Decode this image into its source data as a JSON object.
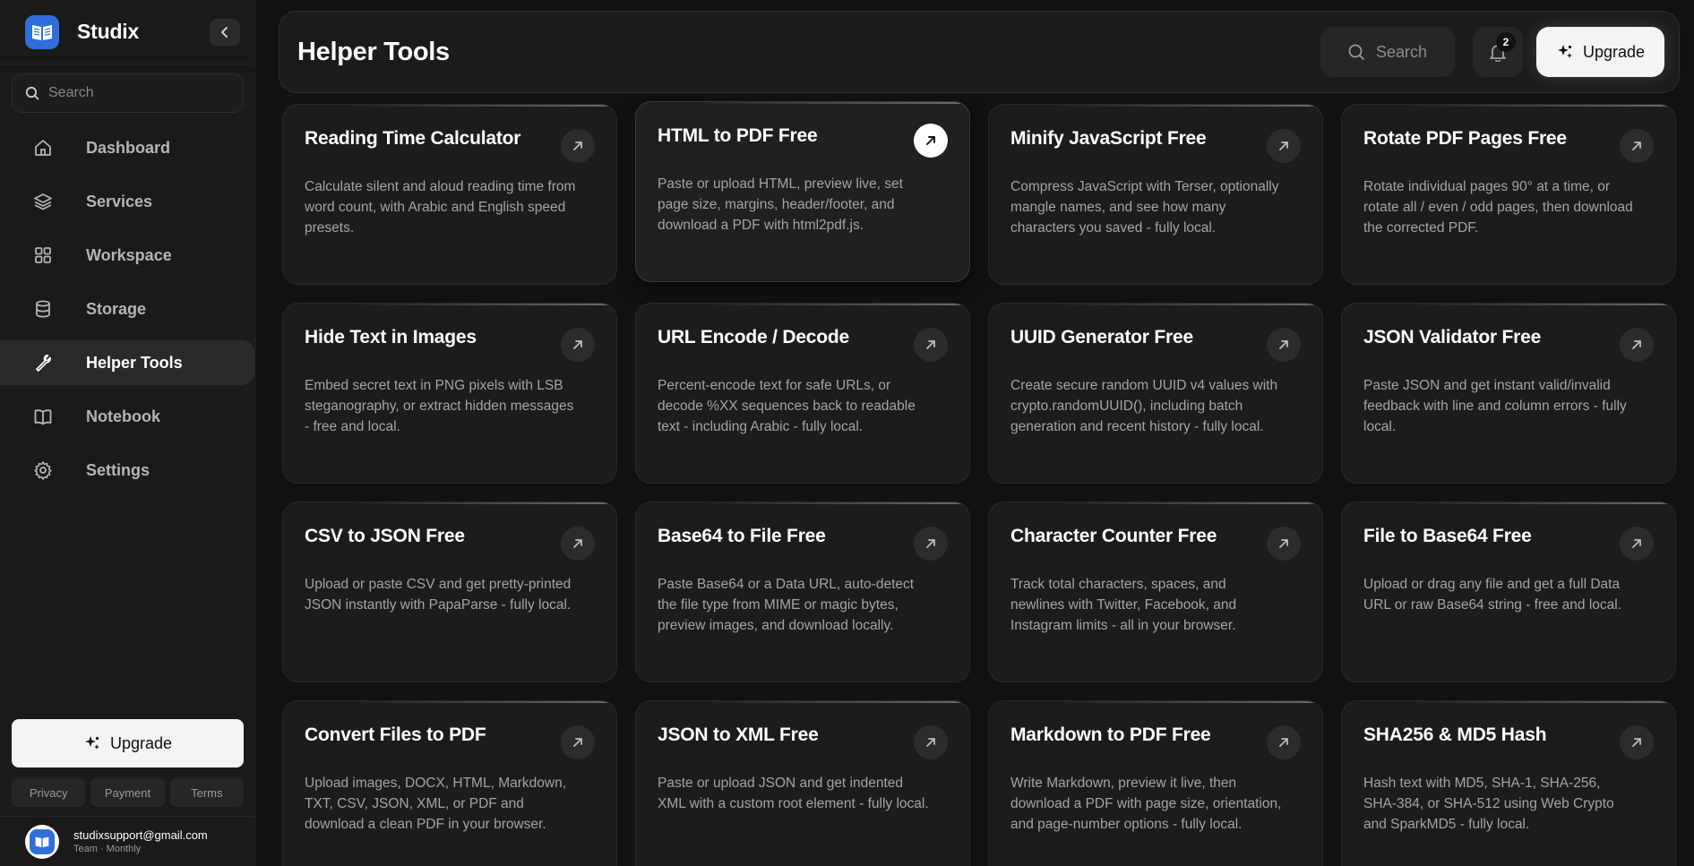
{
  "app": {
    "name": "Studix"
  },
  "sidebar": {
    "search_placeholder": "Search",
    "items": [
      {
        "label": "Dashboard",
        "icon": "home-icon"
      },
      {
        "label": "Services",
        "icon": "layers-icon"
      },
      {
        "label": "Workspace",
        "icon": "grid-icon"
      },
      {
        "label": "Storage",
        "icon": "database-icon"
      },
      {
        "label": "Helper Tools",
        "icon": "wrench-icon",
        "active": true
      },
      {
        "label": "Notebook",
        "icon": "book-icon"
      },
      {
        "label": "Settings",
        "icon": "gear-icon"
      }
    ],
    "upgrade_label": "Upgrade",
    "legal": [
      "Privacy",
      "Payment",
      "Terms"
    ],
    "user": {
      "email": "studixsupport@gmail.com",
      "plan": "Team · Monthly"
    }
  },
  "header": {
    "title": "Helper Tools",
    "search_label": "Search",
    "notification_count": "2",
    "upgrade_label": "Upgrade"
  },
  "tools": [
    {
      "title": "Reading Time Calculator",
      "desc": "Calculate silent and aloud reading time from word count, with Arabic and English speed presets."
    },
    {
      "title": "HTML to PDF Free",
      "desc": "Paste or upload HTML, preview live, set page size, margins, header/footer, and download a PDF with html2pdf.js.",
      "featured": true
    },
    {
      "title": "Minify JavaScript Free",
      "desc": "Compress JavaScript with Terser, optionally mangle names, and see how many characters you saved - fully local."
    },
    {
      "title": "Rotate PDF Pages Free",
      "desc": "Rotate individual pages 90° at a time, or rotate all / even / odd pages, then download the corrected PDF."
    },
    {
      "title": "Hide Text in Images",
      "desc": "Embed secret text in PNG pixels with LSB steganography, or extract hidden messages - free and local."
    },
    {
      "title": "URL Encode / Decode",
      "desc": "Percent-encode text for safe URLs, or decode %XX sequences back to readable text - including Arabic - fully local."
    },
    {
      "title": "UUID Generator Free",
      "desc": "Create secure random UUID v4 values with crypto.randomUUID(), including batch generation and recent history - fully local."
    },
    {
      "title": "JSON Validator Free",
      "desc": "Paste JSON and get instant valid/invalid feedback with line and column errors - fully local."
    },
    {
      "title": "CSV to JSON Free",
      "desc": "Upload or paste CSV and get pretty-printed JSON instantly with PapaParse - fully local."
    },
    {
      "title": "Base64 to File Free",
      "desc": "Paste Base64 or a Data URL, auto-detect the file type from MIME or magic bytes, preview images, and download locally."
    },
    {
      "title": "Character Counter Free",
      "desc": "Track total characters, spaces, and newlines with Twitter, Facebook, and Instagram limits - all in your browser."
    },
    {
      "title": "File to Base64 Free",
      "desc": "Upload or drag any file and get a full Data URL or raw Base64 string - free and local."
    },
    {
      "title": "Convert Files to PDF",
      "desc": "Upload images, DOCX, HTML, Markdown, TXT, CSV, JSON, XML, or PDF and download a clean PDF in your browser."
    },
    {
      "title": "JSON to XML Free",
      "desc": "Paste or upload JSON and get indented XML with a custom root element - fully local."
    },
    {
      "title": "Markdown to PDF Free",
      "desc": "Write Markdown, preview it live, then download a PDF with page size, orientation, and page-number options - fully local."
    },
    {
      "title": "SHA256 & MD5 Hash",
      "desc": "Hash text with MD5, SHA-1, SHA-256, SHA-384, or SHA-512 using Web Crypto and SparkMD5 - fully local."
    }
  ]
}
